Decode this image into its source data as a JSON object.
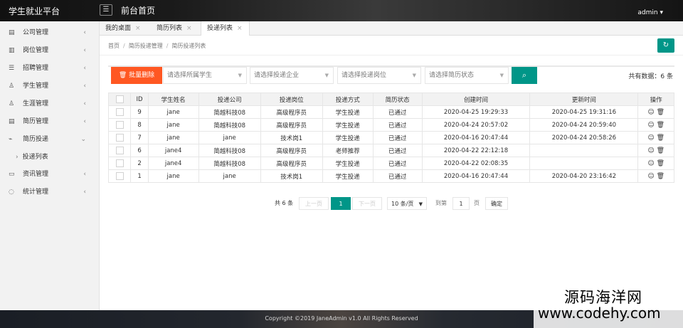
{
  "header": {
    "app_title": "学生就业平台",
    "menu_icon": "hamburger-icon",
    "page_title": "前台首页",
    "user": "admin ▾"
  },
  "sidebar": {
    "items": [
      {
        "label": "公司管理",
        "icon": "building-icon",
        "glyph": "▤",
        "arrow": "‹"
      },
      {
        "label": "岗位管理",
        "icon": "post-icon",
        "glyph": "▥",
        "arrow": "‹"
      },
      {
        "label": "招聘管理",
        "icon": "sliders-icon",
        "glyph": "☰",
        "arrow": "‹"
      },
      {
        "label": "学生管理",
        "icon": "user-icon",
        "glyph": "♙",
        "arrow": "‹"
      },
      {
        "label": "生涯管理",
        "icon": "user-icon",
        "glyph": "♙",
        "arrow": "‹"
      },
      {
        "label": "简历管理",
        "icon": "doc-icon",
        "glyph": "▤",
        "arrow": "‹"
      },
      {
        "label": "简历投递",
        "icon": "send-icon",
        "glyph": "⌁",
        "arrow": "⌄"
      }
    ],
    "sub_item": {
      "label": "投递列表",
      "glyph": "›"
    },
    "items_after": [
      {
        "label": "资讯管理",
        "icon": "book-icon",
        "glyph": "▭",
        "arrow": "‹"
      },
      {
        "label": "统计管理",
        "icon": "chart-icon",
        "glyph": "◌",
        "arrow": "‹"
      }
    ]
  },
  "tabs": [
    {
      "label": "我的桌面",
      "close": "×"
    },
    {
      "label": "简历列表",
      "close": "×"
    },
    {
      "label": "投递列表",
      "close": "×"
    }
  ],
  "breadcrumb": [
    "首页",
    "简历投递管理",
    "简历投递列表"
  ],
  "breadcrumb_sep": "/",
  "toolbar": {
    "batch_delete": "🗑 批量删除",
    "select_student": "请选择所属学生",
    "select_company": "请选择投递企业",
    "select_position": "请选择投递岗位",
    "select_status": "请选择简历状态",
    "total": "共有数据：6 条"
  },
  "table": {
    "headers": [
      "ID",
      "学生姓名",
      "投递公司",
      "投递岗位",
      "投递方式",
      "简历状态",
      "创建时间",
      "更新时间",
      "操作"
    ],
    "rows": [
      [
        "9",
        "jane",
        "简越科技08",
        "高级程序员",
        "学生投递",
        "已通过",
        "2020-04-25 19:29:33",
        "2020-04-25 19:31:16"
      ],
      [
        "8",
        "jane",
        "简越科技08",
        "高级程序员",
        "学生投递",
        "已通过",
        "2020-04-24 20:57:02",
        "2020-04-24 20:59:40"
      ],
      [
        "7",
        "jane",
        "jane",
        "技术岗1",
        "学生投递",
        "已通过",
        "2020-04-16 20:47:44",
        "2020-04-24 20:58:26"
      ],
      [
        "6",
        "jane4",
        "简越科技08",
        "高级程序员",
        "老师推荐",
        "已通过",
        "2020-04-22 22:12:18",
        ""
      ],
      [
        "2",
        "jane4",
        "简越科技08",
        "高级程序员",
        "学生投递",
        "已通过",
        "2020-04-22 02:08:35",
        ""
      ],
      [
        "1",
        "jane",
        "jane",
        "技术岗1",
        "学生投递",
        "已通过",
        "2020-04-16 20:47:44",
        "2020-04-20 23:16:42"
      ]
    ],
    "op_icons": "☺ 🗑"
  },
  "pager": {
    "total": "共 6 条",
    "prev": "上一页",
    "current": "1",
    "next": "下一页",
    "per_page": "10 条/页",
    "goto_label": "到第",
    "goto_value": "1",
    "page_unit": "页",
    "confirm": "确定"
  },
  "footer": {
    "copyright": "Copyright ©2019 JaneAdmin v1.0 All Rights Reserved"
  },
  "watermark": {
    "line1": "源码海洋网",
    "line2": "www.codehy.com"
  },
  "colors": {
    "accent": "#009688",
    "danger": "#ff5722"
  }
}
